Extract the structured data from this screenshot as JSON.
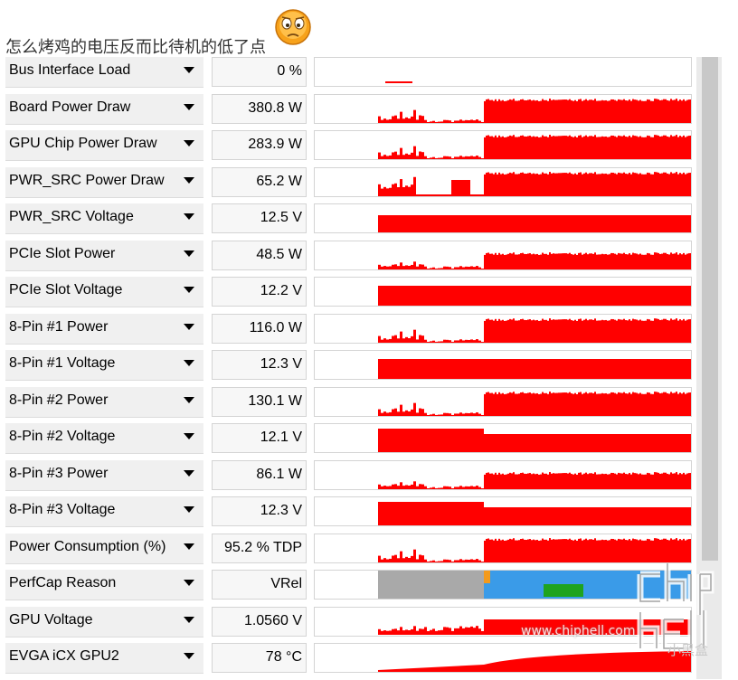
{
  "post": {
    "caption": "怎么烤鸡的电压反而比待机的低了点"
  },
  "sensors": [
    {
      "label": "Bus Interface Load",
      "value": "0 %",
      "graph": "bus"
    },
    {
      "label": "Board Power Draw",
      "value": "380.8 W",
      "graph": "power"
    },
    {
      "label": "GPU Chip Power Draw",
      "value": "283.9 W",
      "graph": "power"
    },
    {
      "label": "PWR_SRC Power Draw",
      "value": "65.2 W",
      "graph": "src"
    },
    {
      "label": "PWR_SRC Voltage",
      "value": "12.5 V",
      "graph": "volt"
    },
    {
      "label": "PCIe Slot Power",
      "value": "48.5 W",
      "graph": "power_low"
    },
    {
      "label": "PCIe Slot Voltage",
      "value": "12.2 V",
      "graph": "volt_full"
    },
    {
      "label": "8-Pin #1 Power",
      "value": "116.0 W",
      "graph": "power"
    },
    {
      "label": "8-Pin #1 Voltage",
      "value": "12.3 V",
      "graph": "volt_full"
    },
    {
      "label": "8-Pin #2 Power",
      "value": "130.1 W",
      "graph": "power"
    },
    {
      "label": "8-Pin #2 Voltage",
      "value": "12.1 V",
      "graph": "volt_drop"
    },
    {
      "label": "8-Pin #3 Power",
      "value": "86.1 W",
      "graph": "power_low"
    },
    {
      "label": "8-Pin #3 Voltage",
      "value": "12.3 V",
      "graph": "volt_drop"
    },
    {
      "label": "Power Consumption (%)",
      "value": "95.2 % TDP",
      "graph": "power"
    },
    {
      "label": "PerfCap Reason",
      "value": "VRel",
      "graph": "perfcap"
    },
    {
      "label": "GPU Voltage",
      "value": "1.0560 V",
      "graph": "gpuv"
    },
    {
      "label": "EVGA iCX GPU2",
      "value": "78 °C",
      "graph": "temp"
    }
  ],
  "colors": {
    "graph_fill": "#ff0000",
    "perfcap_idle": "#a9a9a9",
    "perfcap_vrel": "#3a9be8",
    "perfcap_pwr": "#1fa31f",
    "perfcap_other": "#f39a1c"
  },
  "watermark": {
    "site": "www.chiphell.com",
    "brand": "小黑盒"
  }
}
